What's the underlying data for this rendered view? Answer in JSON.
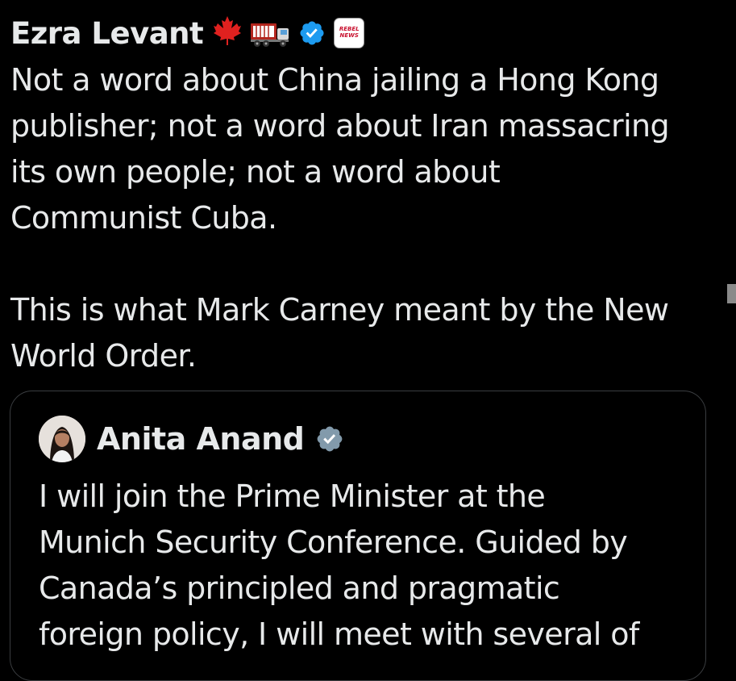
{
  "tweet": {
    "author": {
      "name": "Ezra Levant",
      "icons": [
        "maple-leaf-icon",
        "truck-icon",
        "verified-badge-icon",
        "rebel-news-affiliate-icon"
      ],
      "affiliate_logo_text": "REBEL NEWS"
    },
    "text_lines": [
      "Not a word about China jailing a Hong Kong",
      "publisher; not a word about Iran massacring",
      "its own people; not a word about",
      "Communist Cuba.",
      "",
      "This is what Mark Carney meant by the New",
      "World Order."
    ],
    "quoted": {
      "author": {
        "name": "Anita Anand",
        "icons": [
          "avatar",
          "government-verified-badge-icon"
        ]
      },
      "text_lines": [
        "I will join the Prime Minister at the",
        "Munich Security Conference. Guided by",
        "Canada’s principled and pragmatic",
        "foreign policy, I will meet with several of"
      ]
    }
  },
  "colors": {
    "background": "#000000",
    "text": "#e7e9ea",
    "verified_blue": "#1d9bf0",
    "verified_grey": "#829aab",
    "maple_red": "#e0211f",
    "border": "#3a3d40"
  }
}
